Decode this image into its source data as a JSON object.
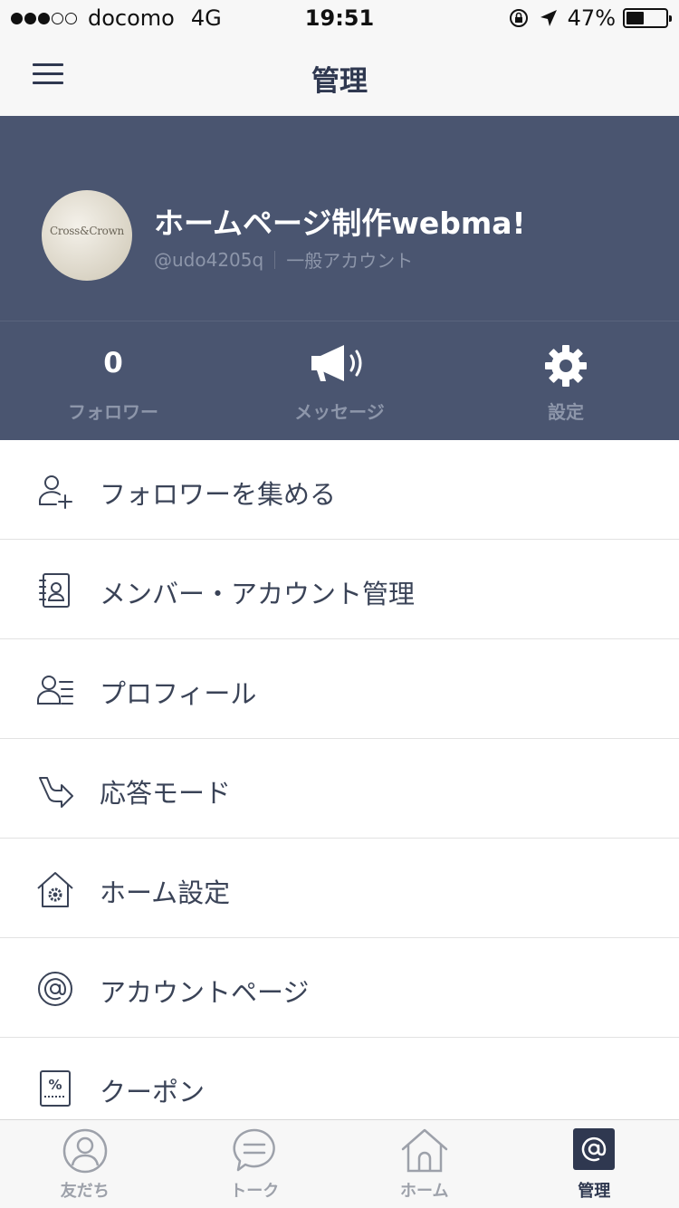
{
  "status_bar": {
    "carrier": "docomo",
    "network": "4G",
    "time": "19:51",
    "battery": "47%",
    "battery_level": 0.47,
    "signal_bars_filled": 3,
    "signal_bars_total": 5
  },
  "nav": {
    "title": "管理",
    "menu_icon": "hamburger-icon"
  },
  "profile": {
    "name": "ホームページ制作webma!",
    "handle": "@udo4205q",
    "account_type": "一般アカウント",
    "avatar_text": "Cross&Crown",
    "background_color": "#4a5570"
  },
  "stats": {
    "followers": {
      "value": "0",
      "label": "フォロワー"
    },
    "message": {
      "label": "メッセージ",
      "icon": "megaphone-icon"
    },
    "settings": {
      "label": "設定",
      "icon": "gear-icon"
    }
  },
  "menu": {
    "items": [
      {
        "label": "フォロワーを集める",
        "icon": "add-follower-icon"
      },
      {
        "label": "メンバー・アカウント管理",
        "icon": "address-book-icon"
      },
      {
        "label": "プロフィール",
        "icon": "profile-icon"
      },
      {
        "label": "応答モード",
        "icon": "reply-arrow-icon"
      },
      {
        "label": "ホーム設定",
        "icon": "home-settings-icon"
      },
      {
        "label": "アカウントページ",
        "icon": "at-sign-icon"
      },
      {
        "label": "クーポン",
        "icon": "coupon-icon"
      }
    ]
  },
  "tabs": {
    "items": [
      {
        "label": "友だち",
        "icon": "friends-icon",
        "active": false
      },
      {
        "label": "トーク",
        "icon": "talk-bubble-icon",
        "active": false
      },
      {
        "label": "ホーム",
        "icon": "home-icon",
        "active": false
      },
      {
        "label": "管理",
        "icon": "manage-at-icon",
        "active": true
      }
    ]
  },
  "colors": {
    "header_bg": "#4a5570",
    "text_primary": "#3a4357",
    "accent": "#2f3850",
    "inactive": "#9da1aa"
  }
}
